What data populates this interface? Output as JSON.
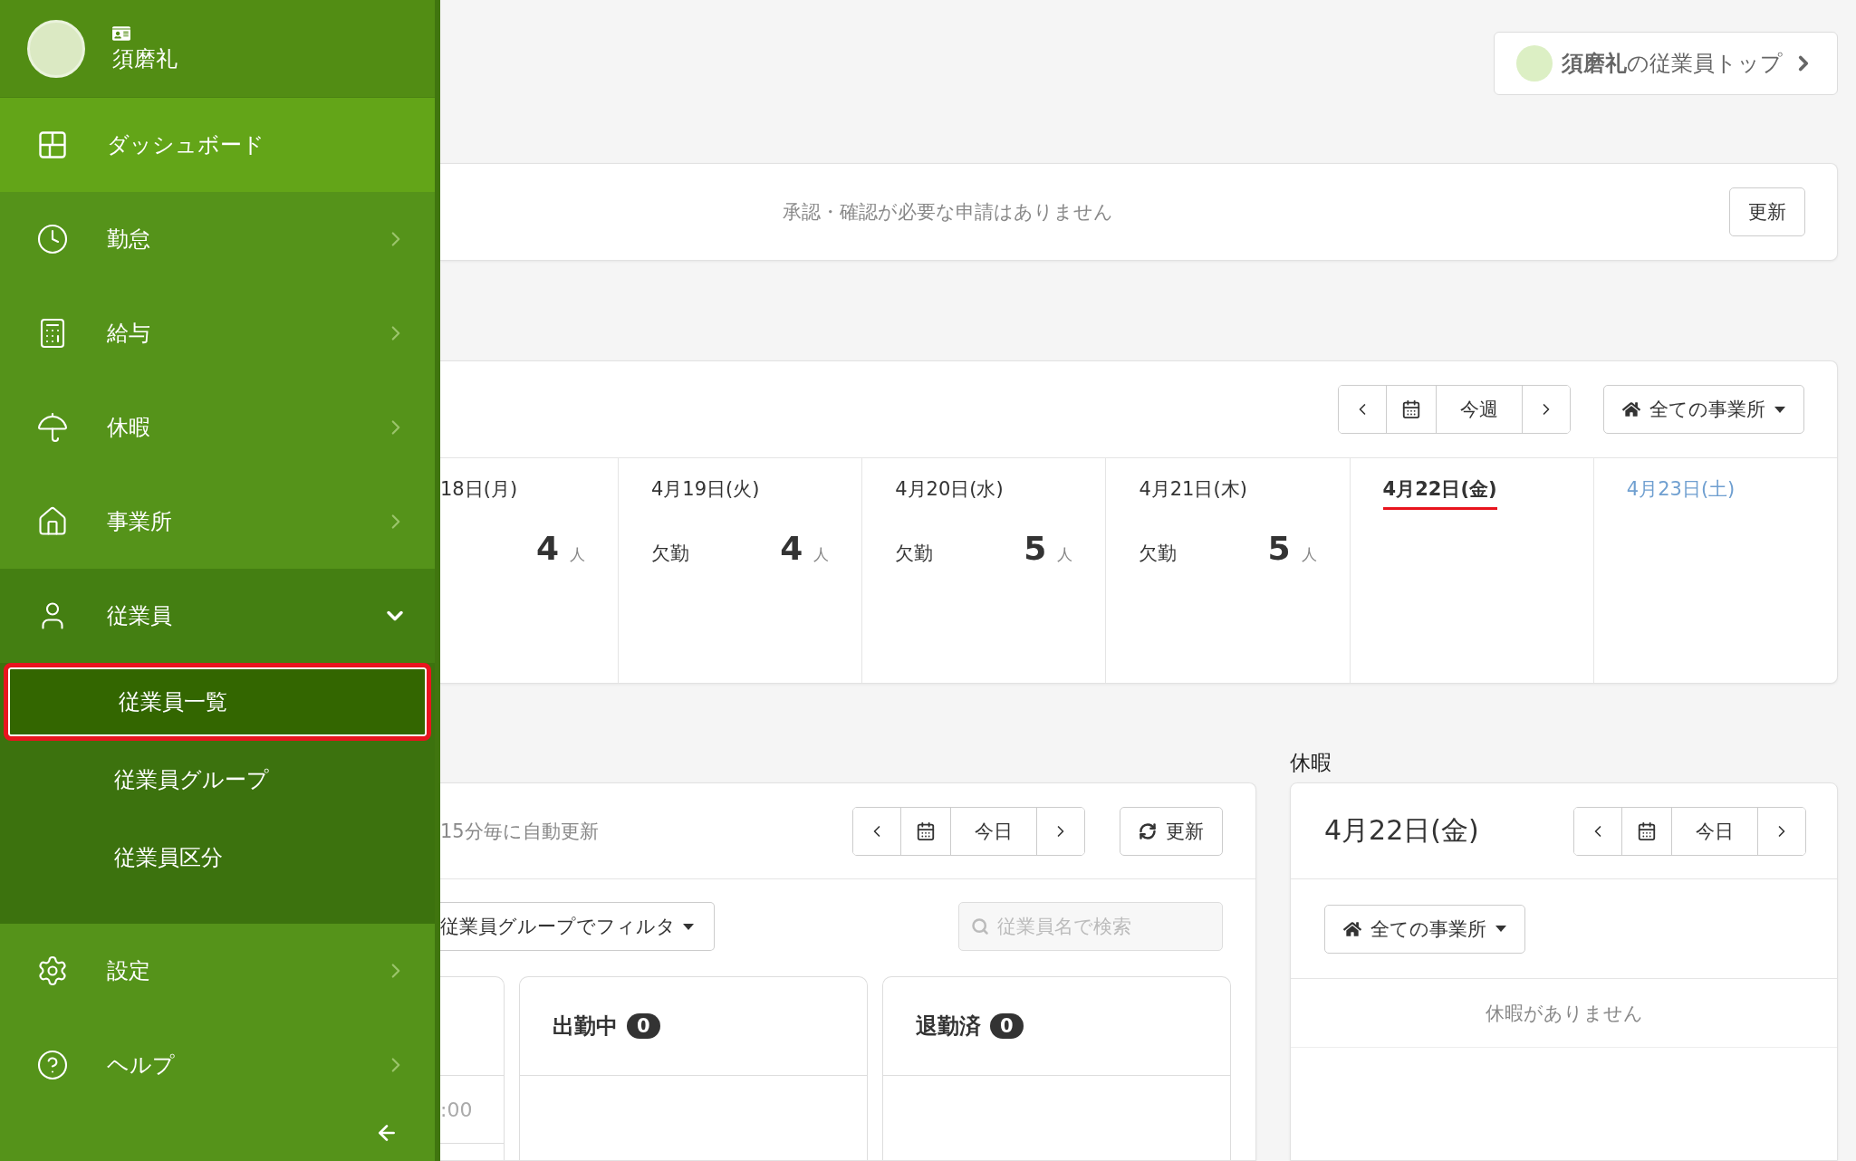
{
  "sidebar": {
    "user": {
      "name": "須磨礼"
    },
    "items": [
      {
        "label": "ダッシュボード",
        "kind": "link",
        "selected": true,
        "expanded": false
      },
      {
        "label": "勤怠",
        "kind": "group",
        "selected": false,
        "expanded": false
      },
      {
        "label": "給与",
        "kind": "group",
        "selected": false,
        "expanded": false
      },
      {
        "label": "休暇",
        "kind": "group",
        "selected": false,
        "expanded": false
      },
      {
        "label": "事業所",
        "kind": "group",
        "selected": false,
        "expanded": false
      },
      {
        "label": "従業員",
        "kind": "group",
        "selected": false,
        "expanded": true,
        "children": [
          {
            "label": "従業員一覧",
            "selected": true,
            "highlighted": true
          },
          {
            "label": "従業員グループ",
            "selected": false,
            "highlighted": false
          },
          {
            "label": "従業員区分",
            "selected": false,
            "highlighted": false
          }
        ]
      },
      {
        "label": "設定",
        "kind": "group",
        "selected": false,
        "expanded": false
      },
      {
        "label": "ヘルプ",
        "kind": "group",
        "selected": false,
        "expanded": false
      }
    ]
  },
  "employee_top_button": {
    "label": "**須磨礼**の従業員トップ"
  },
  "approvals": {
    "message": "承認・確認が必要な申請はありません",
    "button": "更新"
  },
  "week": {
    "nav": {
      "today": "今週"
    },
    "office_filter": "全ての事業所",
    "days": [
      {
        "date": "18日(月)",
        "kind": "weekday",
        "absence": {
          "count": "4",
          "unit": "人"
        }
      },
      {
        "date": "4月19日(火)",
        "kind": "weekday",
        "absence": {
          "label": "欠勤",
          "count": "4",
          "unit": "人"
        }
      },
      {
        "date": "4月20日(水)",
        "kind": "weekday",
        "absence": {
          "label": "欠勤",
          "count": "5",
          "unit": "人"
        }
      },
      {
        "date": "4月21日(木)",
        "kind": "weekday",
        "absence": {
          "label": "欠勤",
          "count": "5",
          "unit": "人"
        }
      },
      {
        "date": "4月22日(金)",
        "kind": "today"
      },
      {
        "date": "4月23日(土)",
        "kind": "saturday"
      }
    ]
  },
  "attendance": {
    "auto_update": "15分毎に自動更新",
    "nav": {
      "today": "今日"
    },
    "refresh": "更新",
    "group_filter": "従業員グループでフィルタ",
    "search": {
      "placeholder": "従業員名で検索"
    },
    "columns": [
      {
        "kind": "partial",
        "cells": [
          ":00"
        ]
      },
      {
        "kind": "status",
        "title": "出勤中",
        "count": "0"
      },
      {
        "kind": "status",
        "title": "退勤済",
        "count": "0"
      }
    ]
  },
  "leave": {
    "heading": "休暇",
    "date": "4月22日(金)",
    "nav": {
      "today": "今日"
    },
    "office_filter": "全ての事業所",
    "empty": "休暇がありません"
  }
}
